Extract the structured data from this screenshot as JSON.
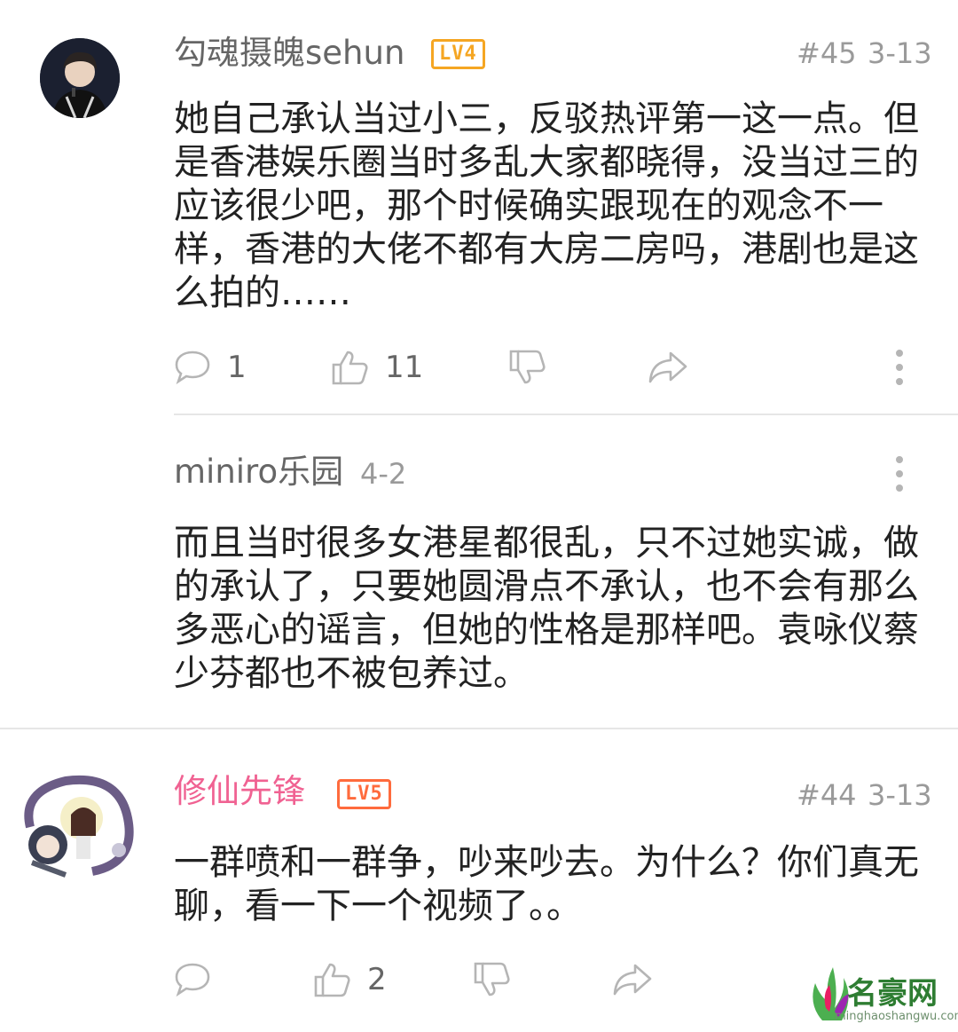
{
  "comments": [
    {
      "author": "勾魂摄魄sehun",
      "level": "LV4",
      "floor": "#45",
      "date": "3-13",
      "text": "她自己承认当过小三，反驳热评第一这一点。但是香港娱乐圈当时多乱大家都晓得，没当过三的应该很少吧，那个时候确实跟现在的观念不一样，香港的大佬不都有大房二房吗，港剧也是这么拍的……",
      "reply_count": "1",
      "like_count": "11"
    },
    {
      "reply_author": "miniro乐园",
      "reply_date": "4-2",
      "reply_text": "而且当时很多女港星都很乱，只不过她实诚，做的承认了，只要她圆滑点不承认，也不会有那么多恶心的谣言，但她的性格是那样吧。袁咏仪蔡少芬都也不被包养过。"
    },
    {
      "author": "修仙先锋",
      "level": "LV5",
      "floor": "#44",
      "date": "3-13",
      "text": "一群喷和一群争，吵来吵去。为什么？你们真无聊，看一下一个视频了。。",
      "like_count": "2"
    }
  ],
  "watermark": {
    "brand": "名豪网",
    "domain": "minghaoshangwu.com"
  },
  "colors": {
    "author_gray": "#666666",
    "author_pink": "#f06292",
    "level_orange": "#f5a623",
    "level_red": "#ff6b3d",
    "icon_gray": "#b5b5b5"
  }
}
